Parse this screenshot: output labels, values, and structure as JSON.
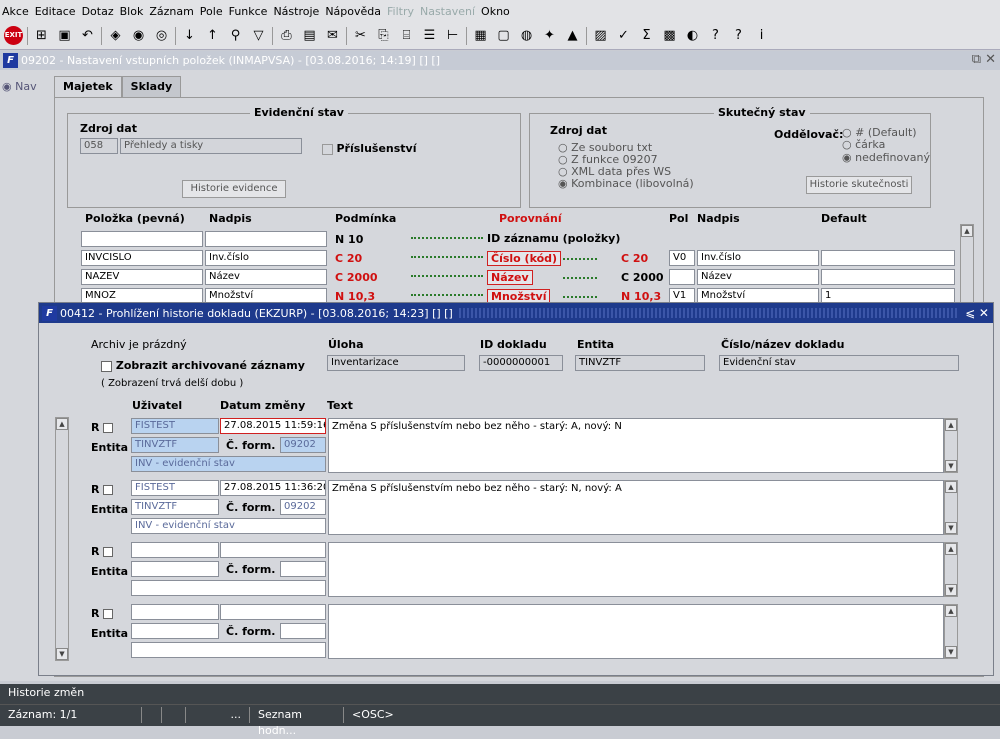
{
  "menu": [
    "Akce",
    "Editace",
    "Dotaz",
    "Blok",
    "Záznam",
    "Pole",
    "Funkce",
    "Nástroje",
    "Nápověda",
    "Filtry",
    "Nastavení",
    "Okno"
  ],
  "window1": {
    "title": "09202 - Nastavení vstupních položek (INMAPVSA) - [03.08.2016; 14:19] [] []",
    "nav": "Nav",
    "tabs": [
      "Majetek",
      "Sklady"
    ],
    "evid": {
      "title": "Evidenční stav",
      "zdroj_label": "Zdroj dat",
      "zdroj_code": "058",
      "zdroj_name": "Přehledy a tisky",
      "prisl": "Příslušenství",
      "historie_btn": "Historie evidence"
    },
    "skut": {
      "title": "Skutečný stav",
      "zdroj_label": "Zdroj dat",
      "r1": "Ze souboru txt",
      "r2": "Z funkce 09207",
      "r3": "XML data přes WS",
      "r4": "Kombinace (libovolná)",
      "odd_label": "Oddělovač:",
      "o1": "# (Default)",
      "o2": "čárka",
      "o3": "nedefinovaný",
      "historie_btn": "Historie skutečnosti"
    },
    "headers": {
      "polozka": "Položka (pevná)",
      "nadpis": "Nadpis",
      "podminka": "Podmínka",
      "porovnani": "Porovnání",
      "pol": "Pol",
      "nadpis2": "Nadpis",
      "default": "Default"
    },
    "rows": [
      {
        "pol": "",
        "nad": "",
        "pod": "N 10",
        "por": "ID záznamu (položky)",
        "pod2": "",
        "p": "",
        "n2": "",
        "d": ""
      },
      {
        "pol": "INVCISLO",
        "nad": "Inv.číslo",
        "pod": "C 20",
        "por": "Číslo (kód)",
        "pod2": "C 20",
        "p": "V0",
        "n2": "Inv.číslo",
        "d": ""
      },
      {
        "pol": "NAZEV",
        "nad": "Název",
        "pod": "C 2000",
        "por": "Název",
        "pod2": "C 2000",
        "p": "",
        "n2": "Název",
        "d": ""
      },
      {
        "pol": "MNOZ",
        "nad": "Množství",
        "pod": "N 10,3",
        "por": "Množství",
        "pod2": "N 10,3",
        "p": "V1",
        "n2": "Množství",
        "d": "1"
      }
    ]
  },
  "window2": {
    "title": "00412 - Prohlížení historie dokladu (EKZURP) - [03.08.2016; 14:23] [] []",
    "archiv": "Archiv je prázdný",
    "zobraz": "Zobrazit archivované záznamy",
    "note": "( Zobrazení trvá delší dobu )",
    "uloha_label": "Úloha",
    "uloha": "Inventarizace",
    "id_label": "ID dokladu",
    "id": "-0000000001",
    "entita_label": "Entita",
    "entita": "TINVZTF",
    "cislo_label": "Číslo/název dokladu",
    "cislo": "Evidenční stav",
    "col_user": "Uživatel",
    "col_date": "Datum změny",
    "col_text": "Text",
    "r_label": "R",
    "entita_row": "Entita",
    "cform": "Č. form.",
    "records": [
      {
        "user": "FISTEST",
        "date": "27.08.2015 11:59:16",
        "entity": "TINVZTF",
        "form": "09202",
        "desc": "INV - evidenční stav",
        "text": "Změna S příslušenstvím nebo bez něho - starý: A, nový: N"
      },
      {
        "user": "FISTEST",
        "date": "27.08.2015 11:36:20",
        "entity": "TINVZTF",
        "form": "09202",
        "desc": "INV - evidenční stav",
        "text": "Změna S příslušenstvím nebo bez něho - starý: N, nový: A"
      },
      {
        "user": "",
        "date": "",
        "entity": "",
        "form": "",
        "desc": "",
        "text": ""
      },
      {
        "user": "",
        "date": "",
        "entity": "",
        "form": "",
        "desc": "",
        "text": ""
      }
    ]
  },
  "status": {
    "title": "Historie změn",
    "zaznam": "Záznam: 1/1",
    "s3": "...",
    "seznam": "Seznam hodn...",
    "osc": "<OSC>"
  }
}
